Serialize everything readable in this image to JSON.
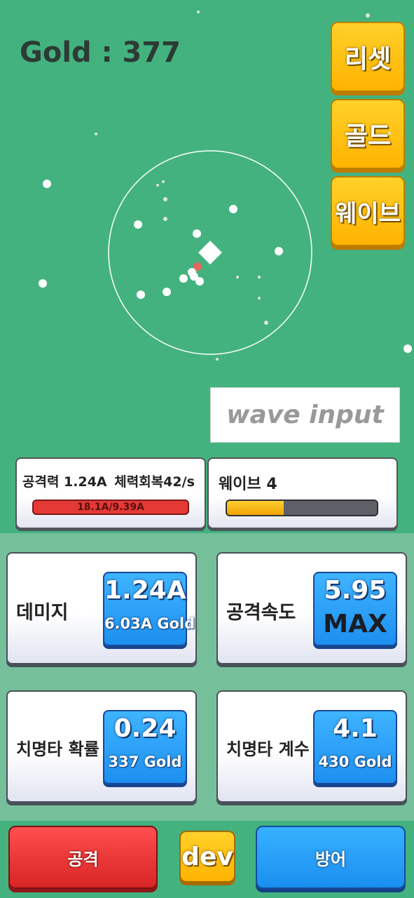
{
  "hud": {
    "gold_text": "Gold : 377"
  },
  "side_buttons": {
    "reset": "리셋",
    "gold": "골드",
    "wave": "웨이브"
  },
  "wave_input": {
    "placeholder": "wave input"
  },
  "status": {
    "attack_text": "공격력 1.24A",
    "regen_text": "체력회복42/s",
    "hp_text": "18.1A/9.39A",
    "hp_color": "#e53935",
    "wave_text": "웨이브 4",
    "wave_progress": 0.38,
    "wave_color": "#f7b500"
  },
  "upgrades": [
    {
      "name": "데미지",
      "value": "1.24A",
      "cost": "6.03A Gold"
    },
    {
      "name": "공격속도",
      "value": "5.95",
      "cost": "MAX"
    },
    {
      "name": "치명타 확률",
      "value": "0.24",
      "cost": "337 Gold"
    },
    {
      "name": "치명타 계수",
      "value": "4.1",
      "cost": "430 Gold"
    }
  ],
  "bottom": {
    "attack": "공격",
    "dev": "dev",
    "defense": "방어"
  },
  "colors": {
    "background": "#43b27f",
    "panel": "#76bf9b",
    "yellow_button": "#ffc107",
    "blue_button": "#1e90ff",
    "red_button": "#e03030",
    "enemy": "#ffffff",
    "projectile": "#e8675e"
  },
  "icons": {
    "tower": "white-diamond-icon",
    "enemy": "white-circle-icon"
  }
}
